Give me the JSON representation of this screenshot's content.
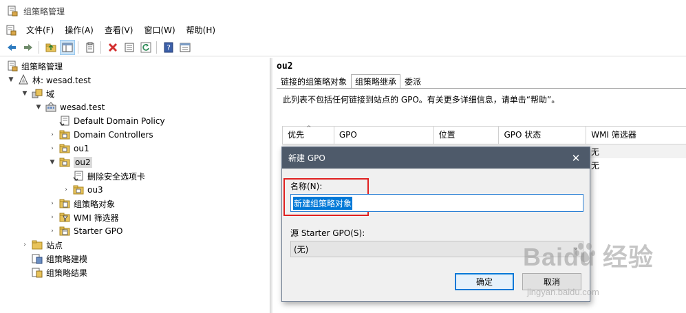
{
  "window": {
    "title": "组策略管理"
  },
  "menu": [
    "文件(F)",
    "操作(A)",
    "查看(V)",
    "窗口(W)",
    "帮助(H)"
  ],
  "toolbar": {
    "icons": [
      "back-arrow-icon",
      "forward-arrow-icon",
      "up-folder-icon",
      "show-hide-tree-icon",
      "clipboard-icon",
      "delete-icon",
      "properties-icon",
      "refresh-icon",
      "help-icon",
      "view-icon"
    ]
  },
  "tree": {
    "root": "组策略管理",
    "forest": "林: wesad.test",
    "domains": "域",
    "domain": "wesad.test",
    "items": [
      "Default Domain Policy",
      "Domain Controllers",
      "ou1",
      "ou2",
      "删除安全选项卡",
      "ou3",
      "组策略对象",
      "WMI 筛选器",
      "Starter GPO"
    ],
    "sites": "站点",
    "modeling": "组策略建模",
    "results": "组策略结果"
  },
  "right": {
    "title": "ou2",
    "tabs": [
      "链接的组策略对象",
      "组策略继承",
      "委派"
    ],
    "active_tab": "组策略继承",
    "description": "此列表不包括任何链接到站点的 GPO。有关更多详细信息，请单击“帮助”。",
    "columns": [
      "优先",
      "GPO",
      "位置",
      "GPO 状态",
      "WMI 筛选器"
    ],
    "rows": [
      {
        "wmi": "无"
      },
      {
        "wmi": "无"
      }
    ]
  },
  "dialog": {
    "title": "新建 GPO",
    "name_label": "名称(N):",
    "name_value": "新建组策略对象",
    "source_label": "源 Starter GPO(S):",
    "source_value": "(无)",
    "ok_label": "确定",
    "cancel_label": "取消"
  },
  "watermark": {
    "brand": "Baidu 经验",
    "url": "jingyan.baidu.com"
  },
  "colors": {
    "dialog_title_bg": "#4e5a6a",
    "highlight_box": "#e02020",
    "selection": "#0078d7"
  }
}
